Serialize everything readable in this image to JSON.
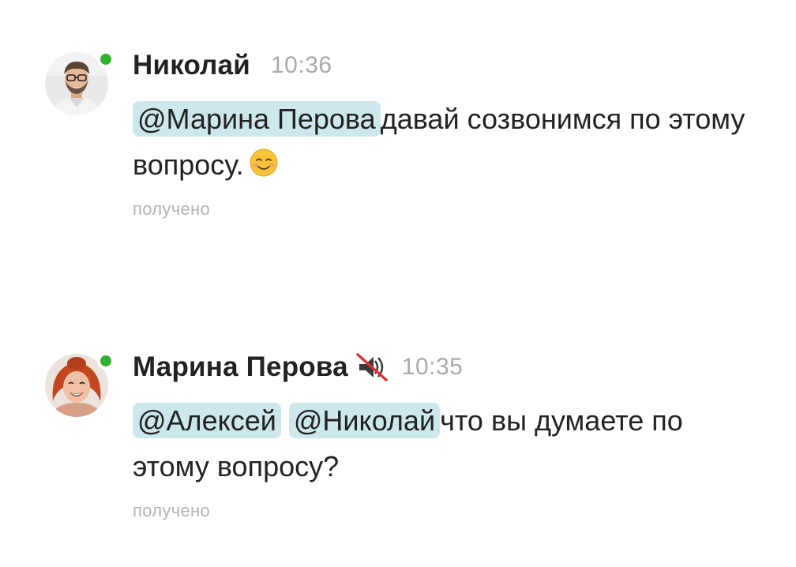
{
  "colors": {
    "mention_bg": "#cde8ec",
    "online": "#2fb12f",
    "meta_text": "#a9a9a9"
  },
  "messages": [
    {
      "author": "Николай",
      "time": "10:36",
      "online": true,
      "avatar_icon": "avatar-man-glasses",
      "mentions": [
        "@Марина Перова"
      ],
      "text": "давай созвонимся по этому вопросу.",
      "emoji": "smiling-face-icon",
      "status": "получено"
    },
    {
      "author": "Марина Перова",
      "author_badge_icon": "muted-speaker-icon",
      "time": "10:35",
      "online": true,
      "avatar_icon": "avatar-woman-red-hair",
      "mentions": [
        "@Алексей",
        "@Николай"
      ],
      "text": "что вы думаете по этому вопросу?",
      "status": "получено"
    }
  ]
}
